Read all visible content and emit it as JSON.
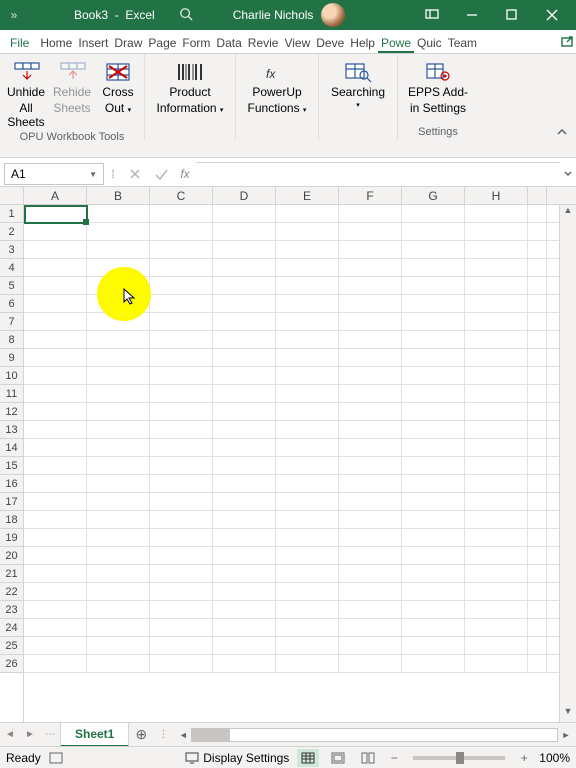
{
  "titlebar": {
    "filename": "Book3",
    "sep": "-",
    "appname": "Excel",
    "user": "Charlie Nichols"
  },
  "tabs": [
    "File",
    "Home",
    "Insert",
    "Draw",
    "Page",
    "Form",
    "Data",
    "Revie",
    "View",
    "Deve",
    "Help",
    "Powe",
    "Quic",
    "Team"
  ],
  "active_tab": "Powe",
  "ribbon": {
    "buttons": [
      {
        "label_l1": "Unhide",
        "label_l2": "All Sheets",
        "disabled": false
      },
      {
        "label_l1": "Rehide",
        "label_l2": "Sheets",
        "disabled": true
      },
      {
        "label_l1": "Cross",
        "label_l2": "Out",
        "disabled": false,
        "dd": true
      },
      {
        "label_l1": "Product",
        "label_l2": "Information",
        "disabled": false,
        "dd": true
      },
      {
        "label_l1": "PowerUp",
        "label_l2": "Functions",
        "disabled": false,
        "dd": true
      },
      {
        "label_l1": "Searching",
        "label_l2": "",
        "disabled": false,
        "dd": true
      },
      {
        "label_l1": "EPPS Add-",
        "label_l2": "in Settings",
        "disabled": false
      }
    ],
    "group1_label": "OPU Workbook Tools",
    "group5_label": "Settings"
  },
  "namebox": "A1",
  "fx_label": "fx",
  "columns": [
    "A",
    "B",
    "C",
    "D",
    "E",
    "F",
    "G",
    "H"
  ],
  "row_count": 26,
  "sheet_tab": "Sheet1",
  "status": {
    "ready": "Ready",
    "display": "Display Settings",
    "zoom": "100%"
  }
}
